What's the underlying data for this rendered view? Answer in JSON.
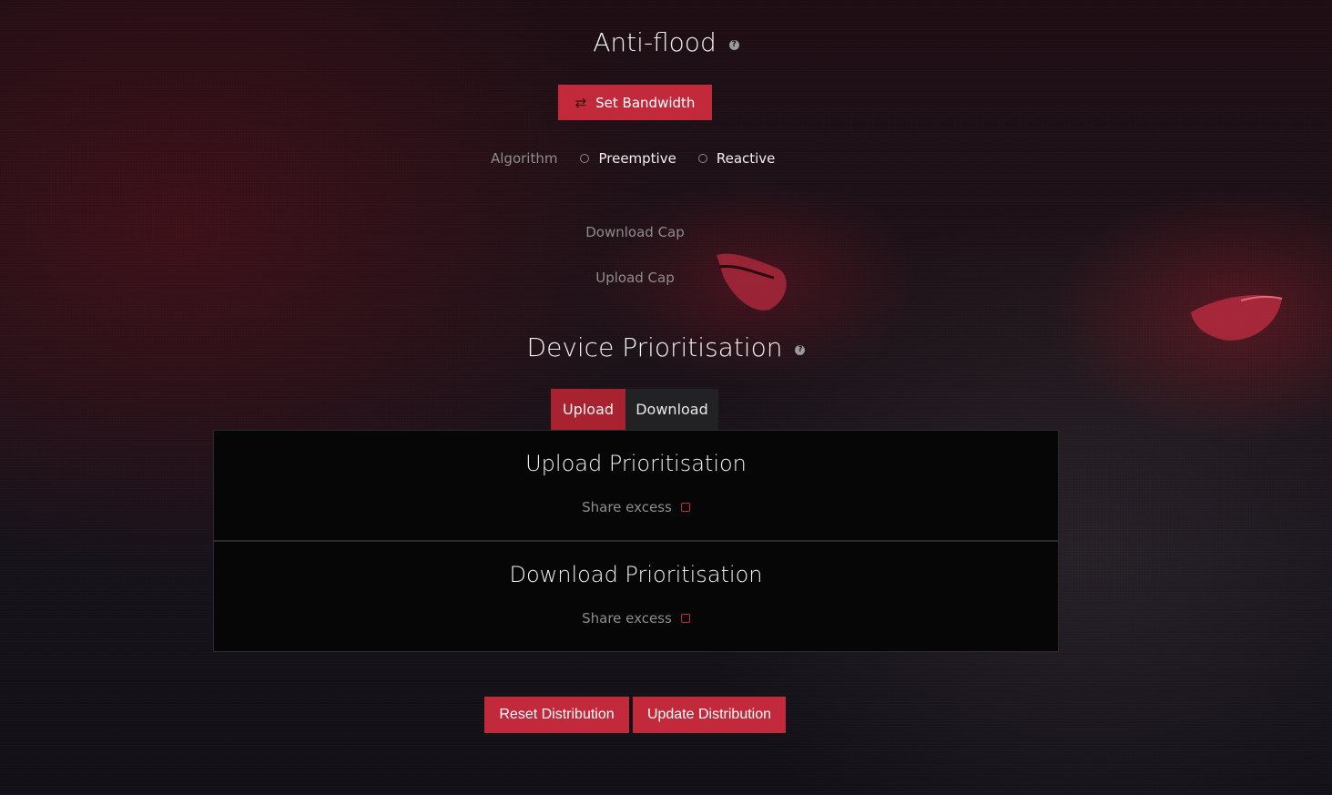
{
  "anti_flood": {
    "title": "Anti-flood",
    "help_icon": "?",
    "set_bandwidth_label": "Set Bandwidth",
    "algorithm_label": "Algorithm",
    "algorithm_options": [
      "Preemptive",
      "Reactive"
    ],
    "download_cap_label": "Download Cap",
    "upload_cap_label": "Upload Cap"
  },
  "device_prioritisation": {
    "title": "Device Prioritisation",
    "help_icon": "?",
    "tabs": [
      {
        "label": "Upload",
        "active": true
      },
      {
        "label": "Download",
        "active": false
      }
    ],
    "upload_panel": {
      "title": "Upload Prioritisation",
      "share_excess_label": "Share excess"
    },
    "download_panel": {
      "title": "Download Prioritisation",
      "share_excess_label": "Share excess"
    }
  },
  "actions": {
    "reset_label": "Reset Distribution",
    "update_label": "Update Distribution"
  },
  "colors": {
    "accent": "#c22a3b",
    "tab_active": "#a8232f",
    "panel_bg": "#060606"
  }
}
